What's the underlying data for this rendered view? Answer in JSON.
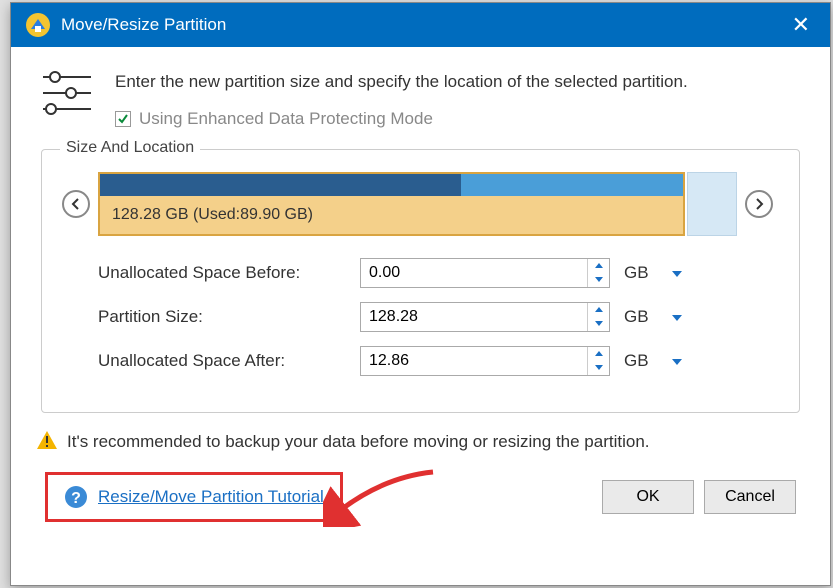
{
  "title": "Move/Resize Partition",
  "intro": "Enter the new partition size and specify the location of the selected partition.",
  "checkbox_label": "Using Enhanced Data Protecting Mode",
  "fieldset_title": "Size And Location",
  "partition_label": "128.28 GB (Used:89.90 GB)",
  "usage_percent": 62,
  "fields": {
    "before": {
      "label": "Unallocated Space Before:",
      "value": "0.00",
      "unit": "GB"
    },
    "size": {
      "label": "Partition Size:",
      "value": "128.28",
      "unit": "GB"
    },
    "after": {
      "label": "Unallocated Space After:",
      "value": "12.86",
      "unit": "GB"
    }
  },
  "warning": "It's recommended to backup your data before moving or resizing the partition.",
  "tutorial": "Resize/Move Partition Tutorial",
  "ok": "OK",
  "cancel": "Cancel"
}
